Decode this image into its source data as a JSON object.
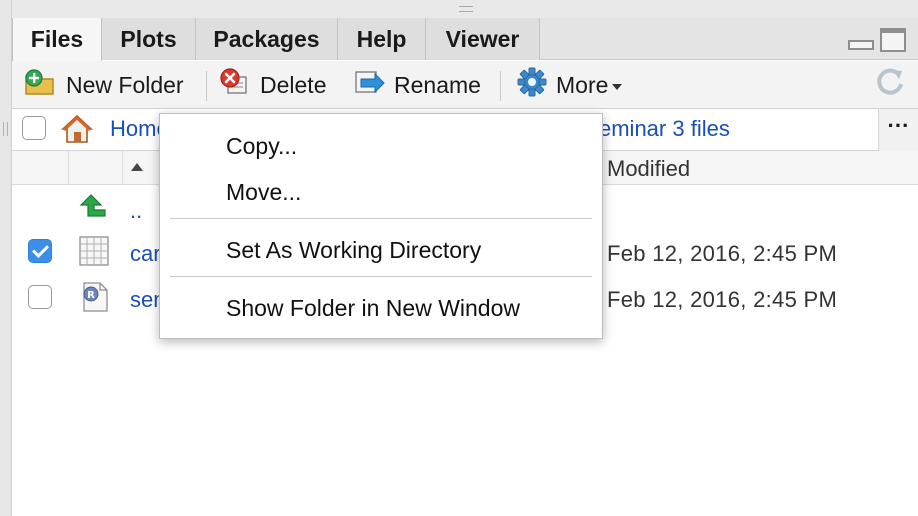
{
  "tabs": [
    {
      "label": "Files",
      "active": true
    },
    {
      "label": "Plots",
      "active": false
    },
    {
      "label": "Packages",
      "active": false
    },
    {
      "label": "Help",
      "active": false
    },
    {
      "label": "Viewer",
      "active": false
    }
  ],
  "toolbar": {
    "new_folder_label": "New Folder",
    "delete_label": "Delete",
    "rename_label": "Rename",
    "more_label": "More"
  },
  "path": {
    "home_label": "Home",
    "folder_label": "seminar 3 files"
  },
  "table": {
    "modified_header": "Modified",
    "rows": [
      {
        "name": "..",
        "type": "parent",
        "modified": "",
        "checked": false
      },
      {
        "name": "car",
        "type": "data",
        "modified": "Feb 12, 2016, 2:45 PM",
        "checked": true
      },
      {
        "name": "sem",
        "type": "r-file",
        "modified": "Feb 12, 2016, 2:45 PM",
        "checked": false
      }
    ]
  },
  "menu": {
    "items": [
      {
        "label": "Copy..."
      },
      {
        "label": "Move..."
      },
      {
        "label": "Set As Working Directory"
      },
      {
        "label": "Show Folder in New Window"
      }
    ]
  },
  "colors": {
    "accent": "#3b8fe8",
    "link": "#1a4fb5",
    "up_arrow": "#2aa84a"
  },
  "icons": {
    "new_folder": "new-folder-icon",
    "delete": "delete-icon",
    "rename": "rename-icon",
    "more": "gear-icon",
    "refresh": "refresh-icon",
    "home": "home-icon",
    "parent": "up-arrow-icon",
    "data_file": "data-table-icon",
    "r_file": "r-file-icon"
  }
}
